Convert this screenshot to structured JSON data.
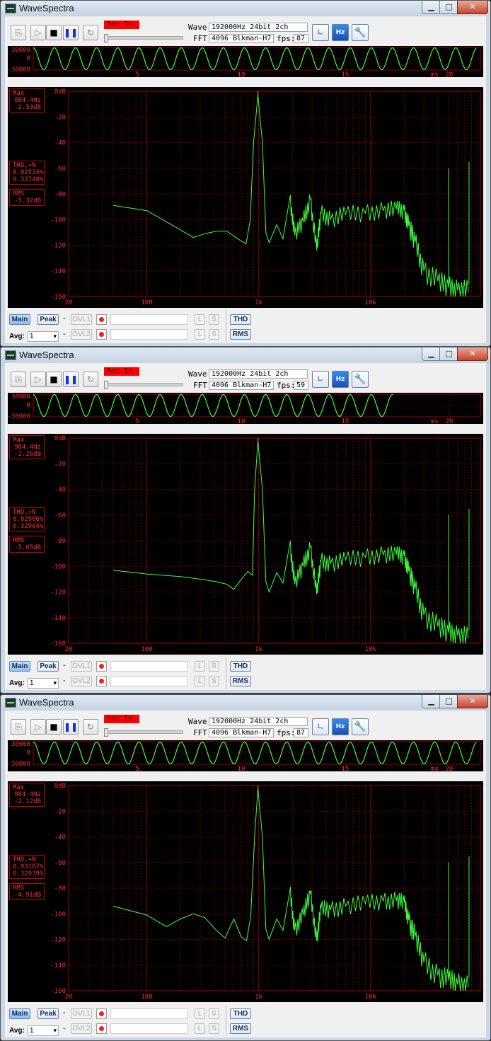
{
  "app": {
    "title": "WaveSpectra",
    "min_glyph": "▁",
    "max_glyph": "□",
    "close_glyph": "✕",
    "rec_label": "Rec.In.",
    "wave_label": "Wave:",
    "fft_label": "FFT:",
    "fps_label": "fps:",
    "ms_label": "ms",
    "wave_x_ticks": [
      "5",
      "10",
      "15",
      "20"
    ],
    "wave_y_ticks": [
      "30000",
      "0",
      "-30000"
    ],
    "spec_x_ticks": [
      "20",
      "100",
      "1k",
      "10k"
    ],
    "spec_y_ticks": [
      "0dB",
      "-20",
      "-40",
      "-60",
      "-80",
      "-100",
      "-120",
      "-140",
      "-160"
    ],
    "max_title": "Max",
    "thd_title": "THD,+N",
    "rms_title": "RMS",
    "btn_main": "Main",
    "btn_peak": "Peak",
    "btn_ovl1": "OVL1",
    "btn_ovl2": "OVL2",
    "btn_l": "L",
    "btn_s": "S",
    "btn_thd": "THD",
    "btn_rms": "RMS",
    "dash": "-",
    "avg_label": "Avg:",
    "avg_value": "1"
  },
  "toolbar_icons": [
    "copy-icon",
    "play-icon",
    "stop-icon",
    "pause-icon",
    "loop-icon",
    "log-scale-icon",
    "hz-db-icon",
    "wrench-icon"
  ],
  "windows": [
    {
      "wave_info": "192000Hz 24bit 2ch",
      "fft_info": "4096 Blkman-H7",
      "fps": "87",
      "max_freq": "984.4Hz",
      "max_db": "-2.53dB",
      "thd": "0.02534%",
      "thdn": "0.32748%",
      "rms": "-5.32dB",
      "wave_end_ms": 21.3,
      "spectrum": [
        [
          50,
          -89
        ],
        [
          100,
          -93
        ],
        [
          200,
          -108
        ],
        [
          260,
          -114
        ],
        [
          330,
          -111
        ],
        [
          420,
          -109
        ],
        [
          520,
          -109
        ],
        [
          650,
          -115
        ],
        [
          770,
          -119
        ],
        [
          840,
          -101
        ],
        [
          900,
          -40
        ],
        [
          984,
          -3
        ],
        [
          1080,
          -40
        ],
        [
          1160,
          -110
        ],
        [
          1240,
          -118
        ],
        [
          1450,
          -104
        ],
        [
          1650,
          -115
        ],
        [
          1900,
          -83
        ],
        [
          2100,
          -112
        ],
        [
          2500,
          -102
        ],
        [
          2900,
          -84
        ],
        [
          3300,
          -124
        ],
        [
          3600,
          -95
        ],
        [
          4400,
          -100
        ],
        [
          6000,
          -96
        ],
        [
          9000,
          -95
        ],
        [
          13000,
          -93
        ],
        [
          17000,
          -92
        ],
        [
          20000,
          -93
        ],
        [
          22000,
          -105
        ],
        [
          25000,
          -118
        ],
        [
          30000,
          -140
        ],
        [
          40000,
          -148
        ],
        [
          50000,
          -153
        ],
        [
          60000,
          -155
        ],
        [
          75000,
          -156
        ]
      ],
      "spurs": [
        [
          50000,
          -60
        ],
        [
          76000,
          -55
        ]
      ]
    },
    {
      "wave_info": "192000Hz 24bit 2ch",
      "fft_info": "4096 Blkman-H7",
      "fps": "59",
      "max_freq": "984.4Hz",
      "max_db": "-2.26dB",
      "thd": "0.02906%",
      "thdn": "0.32904%",
      "rms": "-5.05dB",
      "wave_end_ms": 17.3,
      "spectrum": [
        [
          50,
          -103
        ],
        [
          100,
          -106
        ],
        [
          200,
          -108
        ],
        [
          300,
          -110
        ],
        [
          420,
          -112
        ],
        [
          520,
          -114
        ],
        [
          600,
          -118
        ],
        [
          700,
          -110
        ],
        [
          800,
          -104
        ],
        [
          880,
          -107
        ],
        [
          920,
          -40
        ],
        [
          984,
          -2
        ],
        [
          1080,
          -40
        ],
        [
          1160,
          -112
        ],
        [
          1240,
          -120
        ],
        [
          1450,
          -105
        ],
        [
          1650,
          -113
        ],
        [
          1900,
          -82
        ],
        [
          2100,
          -114
        ],
        [
          2500,
          -100
        ],
        [
          2900,
          -85
        ],
        [
          3300,
          -122
        ],
        [
          3600,
          -96
        ],
        [
          4400,
          -98
        ],
        [
          6000,
          -95
        ],
        [
          9000,
          -93
        ],
        [
          13000,
          -91
        ],
        [
          17000,
          -91
        ],
        [
          20000,
          -92
        ],
        [
          22000,
          -104
        ],
        [
          25000,
          -118
        ],
        [
          30000,
          -138
        ],
        [
          40000,
          -147
        ],
        [
          50000,
          -152
        ],
        [
          60000,
          -154
        ],
        [
          75000,
          -156
        ]
      ],
      "spurs": [
        [
          50000,
          -60
        ],
        [
          76000,
          -55
        ]
      ]
    },
    {
      "wave_info": "192000Hz 24bit 2ch",
      "fft_info": "4096 Blkman-H7",
      "fps": "87",
      "max_freq": "984.4Hz",
      "max_db": "-2.12dB",
      "thd": "0.03107%",
      "thdn": "0.32939%",
      "rms": "-4.91dB",
      "wave_end_ms": 21.3,
      "spectrum": [
        [
          50,
          -94
        ],
        [
          100,
          -101
        ],
        [
          150,
          -110
        ],
        [
          200,
          -104
        ],
        [
          260,
          -100
        ],
        [
          330,
          -103
        ],
        [
          420,
          -113
        ],
        [
          500,
          -119
        ],
        [
          600,
          -104
        ],
        [
          700,
          -118
        ],
        [
          780,
          -121
        ],
        [
          850,
          -102
        ],
        [
          920,
          -40
        ],
        [
          984,
          -2
        ],
        [
          1080,
          -40
        ],
        [
          1160,
          -112
        ],
        [
          1240,
          -120
        ],
        [
          1450,
          -104
        ],
        [
          1650,
          -113
        ],
        [
          1900,
          -82
        ],
        [
          2100,
          -113
        ],
        [
          2500,
          -101
        ],
        [
          2900,
          -84
        ],
        [
          3300,
          -121
        ],
        [
          3600,
          -96
        ],
        [
          4400,
          -97
        ],
        [
          6000,
          -94
        ],
        [
          9000,
          -92
        ],
        [
          13000,
          -90
        ],
        [
          17000,
          -90
        ],
        [
          20000,
          -91
        ],
        [
          22000,
          -105
        ],
        [
          25000,
          -118
        ],
        [
          30000,
          -138
        ],
        [
          40000,
          -148
        ],
        [
          50000,
          -152
        ],
        [
          60000,
          -155
        ],
        [
          75000,
          -157
        ]
      ],
      "spurs": [
        [
          50000,
          -60
        ],
        [
          76000,
          -55
        ]
      ]
    }
  ]
}
